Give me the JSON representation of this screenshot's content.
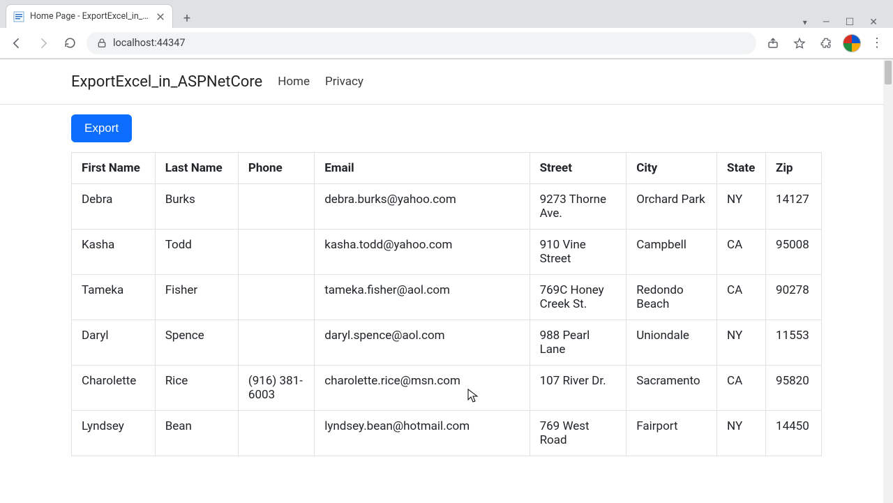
{
  "browser": {
    "tab_title": "Home Page - ExportExcel_in_ASPNetCore",
    "url": "localhost:44347"
  },
  "navbar": {
    "brand": "ExportExcel_in_ASPNetCore",
    "links": [
      "Home",
      "Privacy"
    ]
  },
  "actions": {
    "export_label": "Export"
  },
  "table": {
    "headers": [
      "First Name",
      "Last Name",
      "Phone",
      "Email",
      "Street",
      "City",
      "State",
      "Zip"
    ],
    "rows": [
      {
        "first": "Debra",
        "last": "Burks",
        "phone": "",
        "email": "debra.burks@yahoo.com",
        "street": "9273 Thorne Ave.",
        "city": "Orchard Park",
        "state": "NY",
        "zip": "14127"
      },
      {
        "first": "Kasha",
        "last": "Todd",
        "phone": "",
        "email": "kasha.todd@yahoo.com",
        "street": "910 Vine Street",
        "city": "Campbell",
        "state": "CA",
        "zip": "95008"
      },
      {
        "first": "Tameka",
        "last": "Fisher",
        "phone": "",
        "email": "tameka.fisher@aol.com",
        "street": "769C Honey Creek St.",
        "city": "Redondo Beach",
        "state": "CA",
        "zip": "90278"
      },
      {
        "first": "Daryl",
        "last": "Spence",
        "phone": "",
        "email": "daryl.spence@aol.com",
        "street": "988 Pearl Lane",
        "city": "Uniondale",
        "state": "NY",
        "zip": "11553"
      },
      {
        "first": "Charolette",
        "last": "Rice",
        "phone": "(916) 381-6003",
        "email": "charolette.rice@msn.com",
        "street": "107 River Dr.",
        "city": "Sacramento",
        "state": "CA",
        "zip": "95820"
      },
      {
        "first": "Lyndsey",
        "last": "Bean",
        "phone": "",
        "email": "lyndsey.bean@hotmail.com",
        "street": "769 West Road",
        "city": "Fairport",
        "state": "NY",
        "zip": "14450"
      }
    ]
  }
}
